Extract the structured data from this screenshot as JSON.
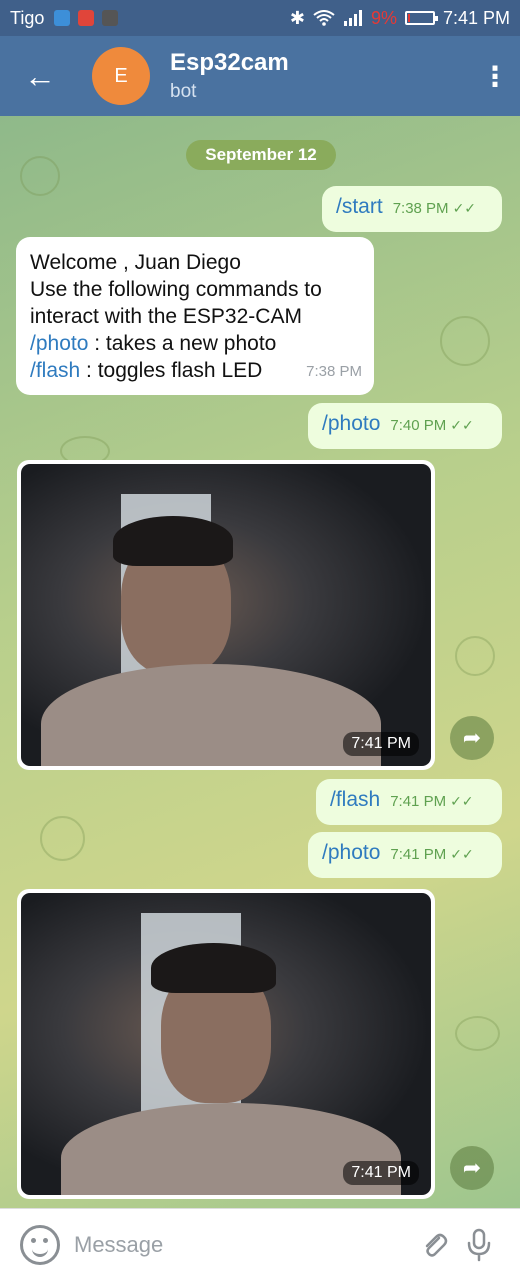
{
  "status_bar": {
    "carrier": "Tigo",
    "battery_percent": "9%",
    "battery_level": 0.09,
    "time": "7:41 PM"
  },
  "header": {
    "avatar_letter": "E",
    "title": "Esp32cam",
    "subtitle": "bot"
  },
  "chat": {
    "date_label": "September 12",
    "messages": [
      {
        "text": "/start",
        "time": "7:38 PM"
      },
      {
        "lines": [
          "Welcome , Juan Diego",
          "Use the following commands to",
          "interact with the ESP32-CAM"
        ],
        "photo_cmd": "/photo",
        "photo_desc": " : takes a new photo",
        "flash_cmd": "/flash",
        "flash_desc": " : toggles flash LED",
        "time": "7:38 PM"
      },
      {
        "text": "/photo",
        "time": "7:40 PM"
      },
      {
        "time": "7:41 PM"
      },
      {
        "text": "/flash",
        "time": "7:41 PM"
      },
      {
        "text": "/photo",
        "time": "7:41 PM"
      },
      {
        "time": "7:41 PM"
      }
    ]
  },
  "input": {
    "placeholder": "Message"
  },
  "colors": {
    "header_bg": "#4a72a0",
    "status_bg": "#40608a",
    "avatar": "#ef8a3c",
    "command_link": "#2f7bbf",
    "outgoing_bubble": "#eefdde",
    "read_check": "#5fa150"
  },
  "icons": [
    "back-arrow-icon",
    "more-vert-icon",
    "double-check-icon",
    "forward-icon",
    "emoji-icon",
    "attach-icon",
    "mic-icon",
    "bluetooth-icon",
    "wifi-icon",
    "signal-icon",
    "battery-icon"
  ]
}
